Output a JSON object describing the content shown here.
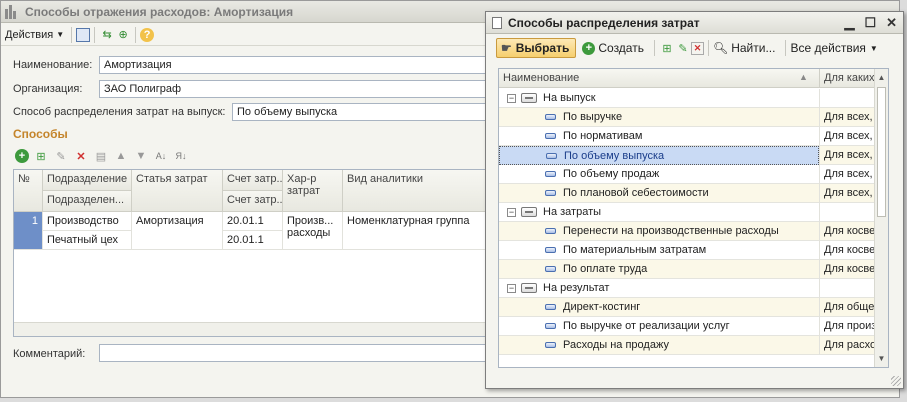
{
  "main_window": {
    "title": "Способы отражения расходов: Амортизация",
    "toolbar": {
      "actions_label": "Действия"
    },
    "fields": {
      "name_label": "Наименование:",
      "name_value": "Амортизация",
      "org_label": "Организация:",
      "org_value": "ЗАО Полиграф",
      "method_label": "Способ распределения затрат на выпуск:",
      "method_value": "По объему выпуска"
    },
    "section_title": "Способы",
    "table": {
      "headers": {
        "num": "№",
        "subdivision": "Подразделение",
        "subdivision2": "Подразделен...",
        "cost_item": "Статья затрат",
        "account": "Счет затр...",
        "account2": "Счет затр...",
        "cost_type": "Хар-р затрат",
        "analytics": "Вид аналитики"
      },
      "row": {
        "num": "1",
        "subdivision": "Производство",
        "subdivision2": "Печатный цех",
        "cost_item": "Амортизация",
        "account": "20.01.1",
        "account2": "20.01.1",
        "cost_type": "Произв... расходы",
        "analytics": "Номенклатурная группа"
      }
    },
    "comment_label": "Комментарий:"
  },
  "popup": {
    "title": "Способы распределения затрат",
    "toolbar": {
      "select_label": "Выбрать",
      "create_label": "Создать",
      "find_label": "Найти...",
      "all_actions_label": "Все действия"
    },
    "columns": {
      "name": "Наименование",
      "desc": "Для каких"
    },
    "rows": [
      {
        "name": "На выпуск",
        "desc": ""
      },
      {
        "name": "По выручке",
        "desc": "Для всех,"
      },
      {
        "name": "По нормативам",
        "desc": "Для всех,"
      },
      {
        "name": "По объему выпуска",
        "desc": "Для всех,"
      },
      {
        "name": "По объему продаж",
        "desc": "Для всех,"
      },
      {
        "name": "По плановой себестоимости",
        "desc": "Для всех,"
      },
      {
        "name": "На затраты",
        "desc": ""
      },
      {
        "name": "Перенести на производственные расходы",
        "desc": "Для косве"
      },
      {
        "name": "По материальным затратам",
        "desc": "Для косве"
      },
      {
        "name": "По оплате труда",
        "desc": "Для косве"
      },
      {
        "name": "На результат",
        "desc": ""
      },
      {
        "name": "Директ-костинг",
        "desc": "Для обще"
      },
      {
        "name": "По выручке от реализации услуг",
        "desc": "Для произ"
      },
      {
        "name": "Расходы на продажу",
        "desc": "Для расхо"
      }
    ]
  }
}
